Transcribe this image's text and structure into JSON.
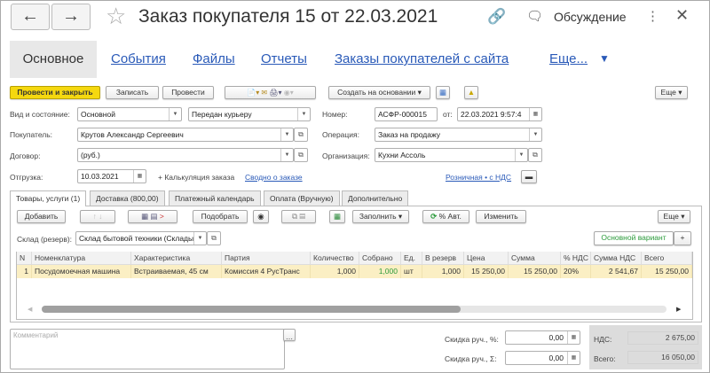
{
  "window": {
    "title": "Заказ покупателя 15 от 22.03.2021",
    "discussion": "Обсуждение"
  },
  "nav_tabs": [
    "Основное",
    "События",
    "Файлы",
    "Отчеты",
    "Заказы покупателей с сайта",
    "Еще..."
  ],
  "toolbar": {
    "post_close": "Провести и закрыть",
    "save": "Записать",
    "post": "Провести",
    "create_based": "Создать на основании",
    "more": "Еще"
  },
  "form": {
    "state_label": "Вид и состояние:",
    "state_kind": "Основной",
    "state": "Передан курьеру",
    "number_label": "Номер:",
    "number": "АСФР-000015",
    "date_label": "от:",
    "date": "22.03.2021  9:57:4",
    "buyer_label": "Покупатель:",
    "buyer": "Крутов Александр Сергеевич",
    "operation_label": "Операция:",
    "operation": "Заказ на продажу",
    "contract_label": "Договор:",
    "contract": "(руб.)",
    "org_label": "Организация:",
    "org": "Кухни Ассоль",
    "shipment_label": "Отгрузка:",
    "shipment": "10.03.2021",
    "calc_link": "+ Калькуляция заказа",
    "summary_link": "Сводно о заказе",
    "price_link": "Розничная • с НДС"
  },
  "inner_tabs": [
    "Товары, услуги (1)",
    "Доставка (800,00)",
    "Платежный календарь",
    "Оплата (Вручную)",
    "Дополнительно"
  ],
  "table_toolbar": {
    "add": "Добавить",
    "pick": "Подобрать",
    "fill": "Заполнить",
    "auto": "% Авт.",
    "change": "Изменить",
    "more": "Еще",
    "variant": "Основной вариант",
    "plus": "+"
  },
  "warehouse": {
    "label": "Склад (резерв):",
    "value": "Склад бытовой техники (Склады"
  },
  "table": {
    "columns": [
      "N",
      "Номенклатура",
      "Характеристика",
      "Партия",
      "Количество",
      "Собрано",
      "Ед.",
      "В резерв",
      "Цена",
      "Сумма",
      "% НДС",
      "Сумма НДС",
      "Всего"
    ],
    "rows": [
      [
        "1",
        "Посудомоечная машина",
        "Встраиваемая, 45 см",
        "Комиссия 4 РусТранс",
        "1,000",
        "1,000",
        "шт",
        "1,000",
        "15 250,00",
        "15 250,00",
        "20%",
        "2 541,67",
        "15 250,00"
      ]
    ]
  },
  "footer": {
    "comment_placeholder": "Комментарий",
    "disc_pct_label": "Скидка руч., %:",
    "disc_pct": "0,00",
    "disc_sum_label": "Скидка руч., Σ:",
    "disc_sum": "0,00",
    "vat_label": "НДС:",
    "vat": "2 675,00",
    "total_label": "Всего:",
    "total": "16 050,00"
  },
  "colors": {
    "accent": "#f5d80f",
    "link": "#2a5ab8",
    "row_selected": "#fbefc4"
  }
}
